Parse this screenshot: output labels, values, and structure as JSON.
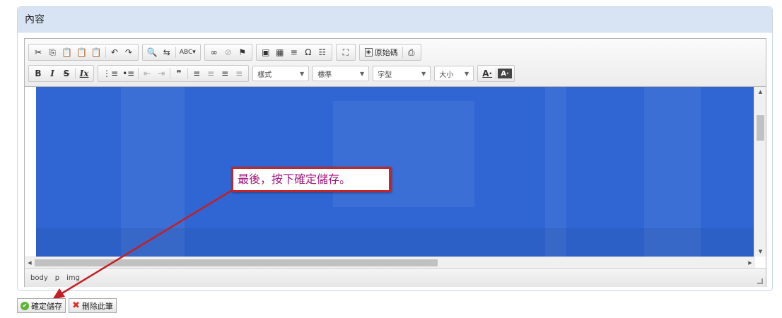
{
  "panel": {
    "title": "內容"
  },
  "toolbar": {
    "row1": [
      [
        "✂",
        "⎘",
        "📋",
        "📋",
        "📋"
      ],
      [
        "↶",
        "↷"
      ],
      [
        "🔍",
        "⇆",
        "ABC▾"
      ],
      [
        "∞",
        "⊘",
        "⚑"
      ],
      [
        "▣",
        "▦",
        "≡",
        "Ω",
        "☷"
      ],
      [
        "⛶"
      ],
      [
        "原始碼"
      ],
      [
        "⎙"
      ]
    ],
    "row2_format": [
      "B",
      "I",
      "S",
      "Ix"
    ],
    "row2_list": [
      "⋮≡",
      "•≡",
      "⇤",
      "⇥",
      "❞"
    ],
    "row2_align": [
      "≡",
      "≡",
      "≡",
      "≡"
    ],
    "combos": [
      {
        "label": "樣式"
      },
      {
        "label": "標準"
      },
      {
        "label": "字型"
      },
      {
        "label": "大小"
      }
    ],
    "text_color": "A·",
    "bg_color": "A·"
  },
  "statusbar": {
    "path": [
      "body",
      "p",
      "img"
    ]
  },
  "callout": {
    "text": "最後，按下確定儲存。"
  },
  "actions": {
    "save_label": "確定儲存",
    "delete_label": "刪除此筆"
  },
  "colors": {
    "image_blue": "#2f66d3",
    "callout_border": "#c0272d",
    "callout_text": "#a1177f",
    "arrow": "#c41f24"
  }
}
